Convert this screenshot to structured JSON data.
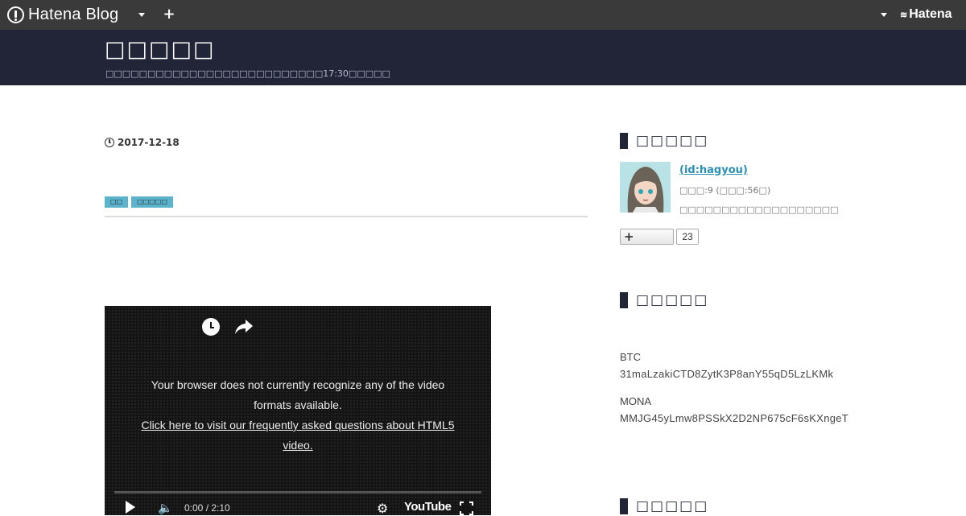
{
  "globalbar": {
    "logo_text": "Hatena Blog",
    "brand_text": "Hatena",
    "brand_mark": "≋"
  },
  "header": {
    "title": "□□□□□",
    "description": "□□□□□□□□□□□□□□□□□□□□□□□□□□17:30□□□□□"
  },
  "entry": {
    "date": "2017-12-18",
    "categories": [
      "□□",
      "□□□□□"
    ]
  },
  "video": {
    "message": "Your browser does not currently recognize any of the video formats available.",
    "link_text": "Click here to visit our frequently asked questions about HTML5 video.",
    "time": "0:00 / 2:10",
    "brand": "YouTube"
  },
  "sidebar": {
    "profile_heading": "□□□□□",
    "profile_name": "(id:hagyou)",
    "profile_meta": "□□□:9 (□□□:56□)",
    "profile_bio": "□□□□□□□□□□□□□□□□□□□",
    "follow_count": "23",
    "donation_heading": "□□□□□",
    "crypto": [
      {
        "label": "BTC",
        "address": "31maLzakiCTD8ZytK3P8anY55qD5LzLKMk"
      },
      {
        "label": "MONA",
        "address": "MMJG45yLmw8PSSkX2D2NP675cF6sKXngeT"
      }
    ],
    "third_heading": "□□□□□"
  },
  "colors": {
    "globalbar_bg": "#3a3a3a",
    "header_bg": "#222538",
    "category_bg": "#5bb3cc",
    "link": "#2a8fb5"
  }
}
